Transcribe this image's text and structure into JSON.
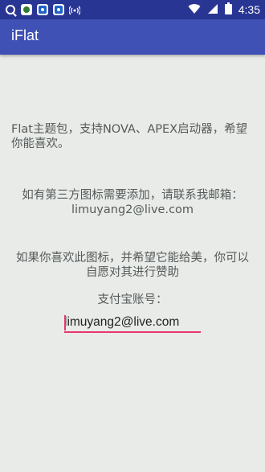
{
  "status_bar": {
    "time": "4:35",
    "icons": [
      "search-icon",
      "app-icon",
      "baidu-icon",
      "baidu-icon",
      "broadcast-icon",
      "wifi-icon",
      "signal-icon",
      "battery-icon"
    ]
  },
  "app_bar": {
    "title": "iFlat"
  },
  "main": {
    "intro": "Flat主题包，支持NOVA、APEX启动器，希望你能喜欢。",
    "contact_line": "如有第三方图标需要添加，请联系我邮箱：limuyang2@live.com",
    "donate_line": "如果你喜欢此图标，并希望它能给美，你可以自愿对其进行赞助",
    "alipay_label": "支付宝账号：",
    "alipay_value": "limuyang2@live.com"
  },
  "colors": {
    "status_bar": "#283593",
    "app_bar": "#3f51b5",
    "background": "#e8ebe7",
    "text": "#555a5b",
    "accent": "#e8356f"
  }
}
